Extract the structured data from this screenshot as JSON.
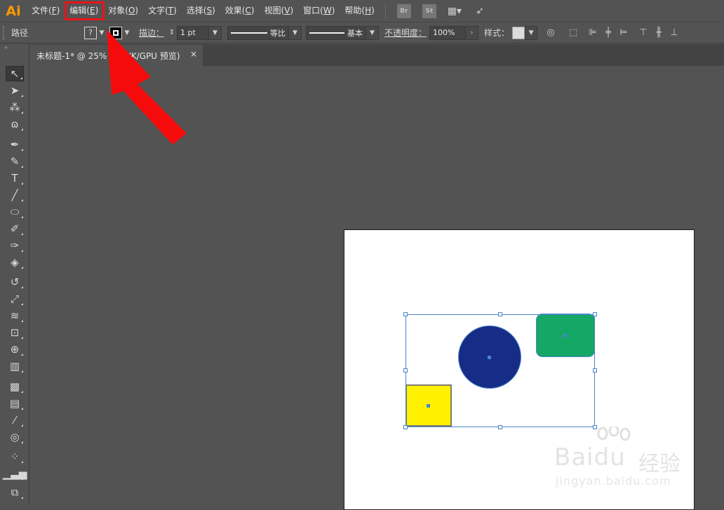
{
  "app": {
    "logo": "Ai",
    "logo_color": "#ff9a00"
  },
  "menu": {
    "items": [
      {
        "label": "文件(",
        "key": "F",
        "tail": ")"
      },
      {
        "label": "编辑(",
        "key": "E",
        "tail": ")"
      },
      {
        "label": "对象(",
        "key": "O",
        "tail": ")"
      },
      {
        "label": "文字(",
        "key": "T",
        "tail": ")"
      },
      {
        "label": "选择(",
        "key": "S",
        "tail": ")"
      },
      {
        "label": "效果(",
        "key": "C",
        "tail": ")"
      },
      {
        "label": "视图(",
        "key": "V",
        "tail": ")"
      },
      {
        "label": "窗口(",
        "key": "W",
        "tail": ")"
      },
      {
        "label": "帮助(",
        "key": "H",
        "tail": ")"
      }
    ],
    "highlighted": "编辑(E)",
    "bridge_icon": "Br",
    "stock_icon": "St"
  },
  "control": {
    "path_label": "路径",
    "fill_label": "?",
    "stroke_label": "描边：",
    "stroke_weight": "1 pt",
    "profile_label": "等比",
    "brush_label": "基本",
    "opacity_label": "不透明度：",
    "opacity_value": "100%",
    "style_label": "样式："
  },
  "tab": {
    "title": "未标题-1* @ 25% (CMYK/GPU 预览)",
    "close": "×"
  },
  "colors": {
    "highlight_box": "#e8141b",
    "arrow": "#f50b0b",
    "selection": "#4a86c8",
    "yellow_rect": "#fff100",
    "blue_circle": "#172c86",
    "green_rect": "#14a765"
  },
  "watermark": {
    "brand": "Bai",
    "brand2": "du",
    "sub": "经验",
    "url": "jingyan.baidu.com"
  }
}
